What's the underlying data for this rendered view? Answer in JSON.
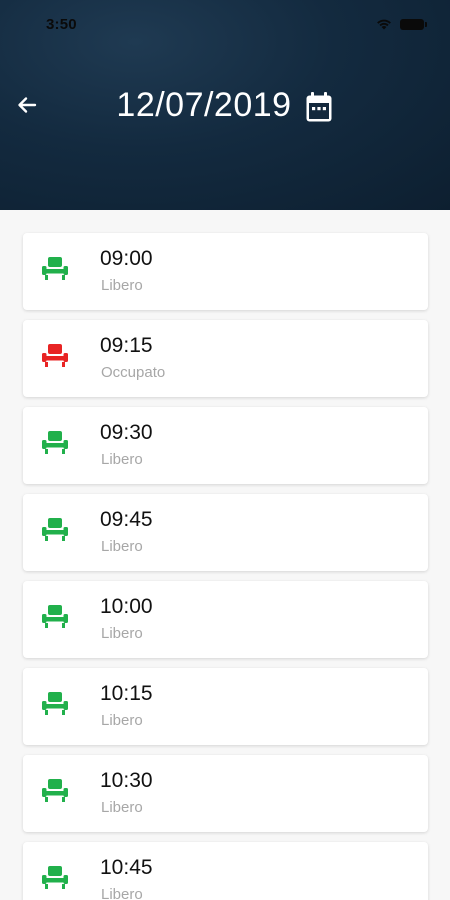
{
  "status_bar": {
    "time": "3:50"
  },
  "header": {
    "title": "12/07/2019"
  },
  "colors": {
    "free": "#21b04b",
    "occupied": "#e82424"
  },
  "slots": [
    {
      "time": "09:00",
      "status": "Libero",
      "state": "free"
    },
    {
      "time": "09:15",
      "status": "Occupato",
      "state": "occupied"
    },
    {
      "time": "09:30",
      "status": "Libero",
      "state": "free"
    },
    {
      "time": "09:45",
      "status": "Libero",
      "state": "free"
    },
    {
      "time": "10:00",
      "status": "Libero",
      "state": "free"
    },
    {
      "time": "10:15",
      "status": "Libero",
      "state": "free"
    },
    {
      "time": "10:30",
      "status": "Libero",
      "state": "free"
    },
    {
      "time": "10:45",
      "status": "Libero",
      "state": "free"
    }
  ]
}
